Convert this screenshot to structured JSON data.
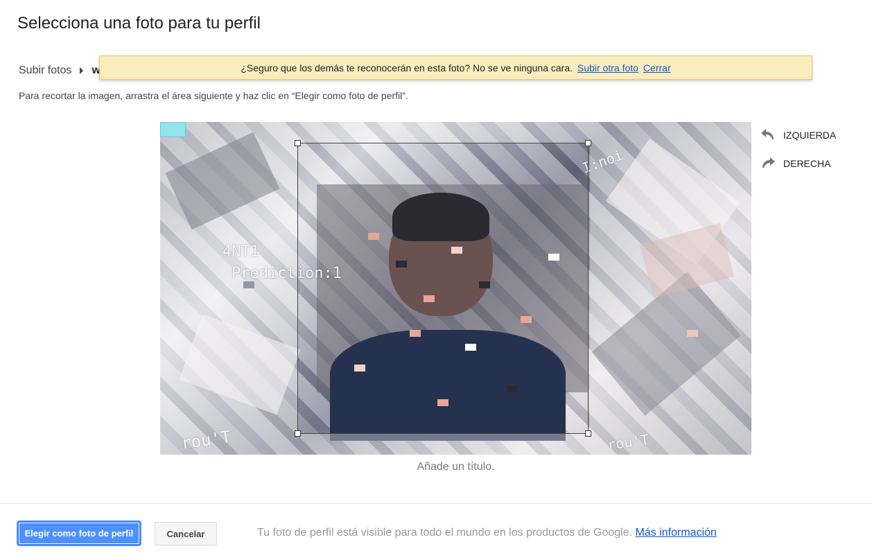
{
  "dialog": {
    "title": "Selecciona una foto para tu perfil"
  },
  "breadcrumb": {
    "items": [
      "Subir fotos",
      "w"
    ]
  },
  "warning": {
    "message": "¿Seguro que los demás te reconocerán en esta foto? No se ve ninguna cara.",
    "upload_other_link": "Subir otra foto",
    "close_link": "Cerrar"
  },
  "instructions": "Para recortar la imagen, arrastra el área siguiente y haz clic en “Elegir como foto de perfil”.",
  "photo": {
    "overlay_lines": [
      "4NT1",
      "Prediction:1"
    ],
    "corner_text_left": "rou'T",
    "corner_text_right": "rou'T",
    "top_right_text": "I:noi"
  },
  "rotate": {
    "left_label": "IZQUIERDA",
    "right_label": "DERECHA"
  },
  "caption_placeholder": "Añade un título.",
  "footer": {
    "primary_button": "Elegir como foto de perfil",
    "cancel_button": "Cancelar",
    "visibility_note": "Tu foto de perfil está visible para todo el mundo en los productos de Google.",
    "more_info_link": "Más información"
  },
  "colors": {
    "primary_button": "#4d90fe",
    "warning_bg": "#f9edbe",
    "link": "#1155cc"
  },
  "icons": {
    "rotate_left": "rotate-left-icon",
    "rotate_right": "rotate-right-icon",
    "breadcrumb_separator": "caret-right-icon"
  }
}
